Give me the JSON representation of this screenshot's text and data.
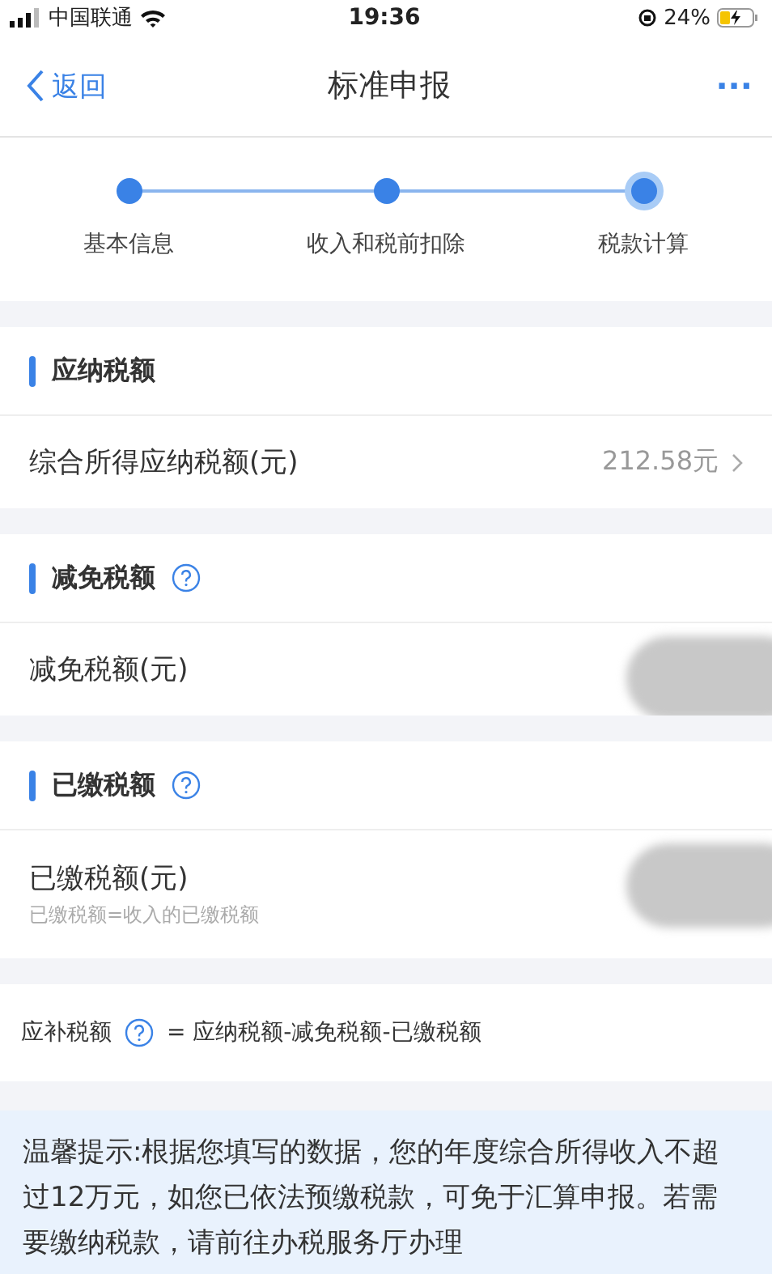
{
  "status_bar": {
    "carrier": "中国联通",
    "time": "19:36",
    "battery": "24%"
  },
  "nav": {
    "back": "返回",
    "title": "标准申报",
    "more": "···"
  },
  "steps": [
    {
      "label": "基本信息",
      "selected": false
    },
    {
      "label": "收入和税前扣除",
      "selected": false
    },
    {
      "label": "税款计算",
      "selected": true
    }
  ],
  "sections": [
    {
      "title": "应纳税额",
      "help": false,
      "row": {
        "label": "综合所得应纳税额(元)",
        "value": "212.58元",
        "blurred": false
      }
    },
    {
      "title": "减免税额",
      "help": true,
      "row": {
        "label": "减免税额(元)",
        "blurred": true
      }
    },
    {
      "title": "已缴税额",
      "help": true,
      "row": {
        "label": "已缴税额(元)",
        "hint": "已缴税额=收入的已缴税额",
        "blurred": true
      }
    }
  ],
  "formula": {
    "label": "应补税额",
    "expression": "= 应纳税额-减免税额-已缴税额"
  },
  "tip": "温馨提示:根据您填写的数据，您的年度综合所得收入不超过12万元，如您已依法预缴税款，可免于汇算申报。若需要缴纳税款，请前往办税服务厅办理"
}
